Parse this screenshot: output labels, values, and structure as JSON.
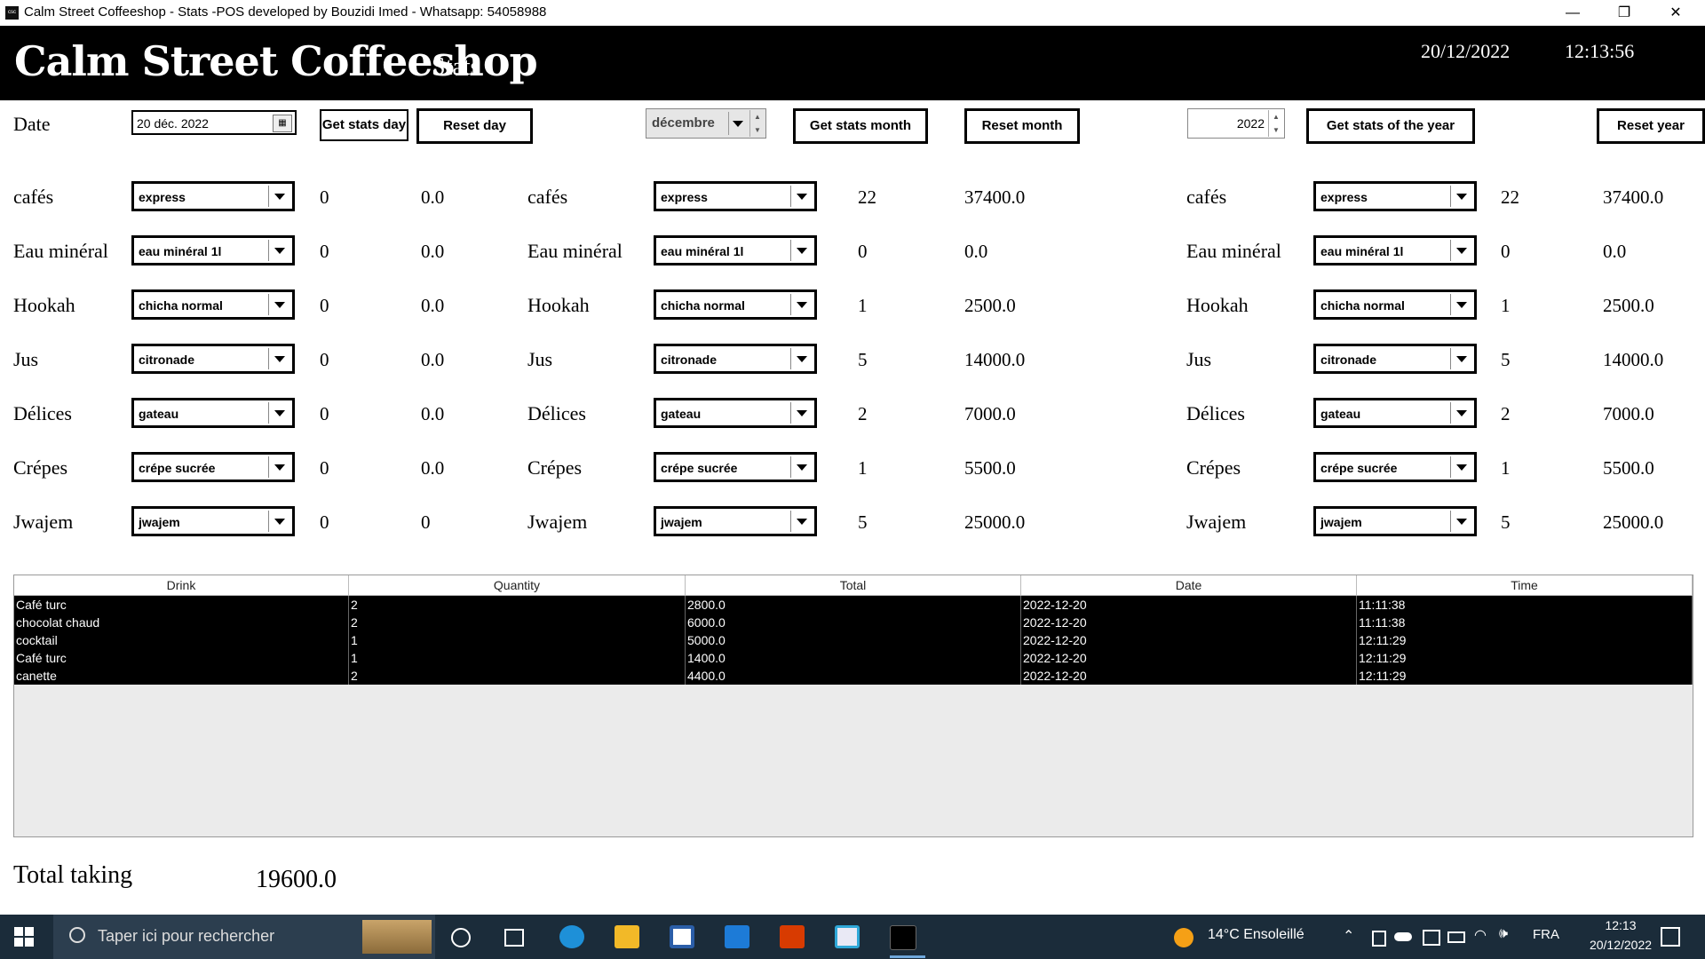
{
  "window": {
    "title": "Calm Street Coffeeshop - Stats -POS developed by Bouzidi Imed - Whatsapp: 54058988",
    "app_icon_text": "csc",
    "minimize": "—",
    "restore": "❐",
    "close": "✕"
  },
  "header": {
    "brand": "Calm Street Coffeeshop",
    "page_title": "Stats",
    "date": "20/12/2022",
    "time": "12:13:56"
  },
  "controls": {
    "date_label": "Date",
    "date_value": "20 déc. 2022",
    "get_day": "Get stats day",
    "reset_day": "Reset day",
    "month_value": "décembre",
    "get_month": "Get stats month",
    "reset_month": "Reset month",
    "year_value": "2022",
    "get_year": "Get stats of the year",
    "reset_year": "Reset year"
  },
  "categories": {
    "day": {
      "labels": [
        "cafés",
        "Eau minéral",
        "Hookah",
        "Jus",
        "Délices",
        "Crépes",
        "Jwajem"
      ],
      "selections": [
        "express",
        "eau minéral 1l",
        "chicha normal",
        "citronade",
        "gateau",
        "crépe sucrée",
        "jwajem"
      ],
      "quantities": [
        "0",
        "0",
        "0",
        "0",
        "0",
        "0",
        "0"
      ],
      "totals": [
        "0.0",
        "0.0",
        "0.0",
        "0.0",
        "0.0",
        "0.0",
        "0"
      ]
    },
    "month": {
      "labels": [
        "cafés",
        "Eau minéral",
        "Hookah",
        "Jus",
        "Délices",
        "Crépes",
        "Jwajem"
      ],
      "selections": [
        "express",
        "eau minéral 1l",
        "chicha normal",
        "citronade",
        "gateau",
        "crépe sucrée",
        "jwajem"
      ],
      "quantities": [
        "22",
        "0",
        "1",
        "5",
        "2",
        "1",
        "5"
      ],
      "totals": [
        "37400.0",
        "0.0",
        "2500.0",
        "14000.0",
        "7000.0",
        "5500.0",
        "25000.0"
      ]
    },
    "year": {
      "labels": [
        "cafés",
        "Eau minéral",
        "Hookah",
        "Jus",
        "Délices",
        "Crépes",
        "Jwajem"
      ],
      "selections": [
        "express",
        "eau minéral 1l",
        "chicha normal",
        "citronade",
        "gateau",
        "crépe sucrée",
        "jwajem"
      ],
      "quantities": [
        "22",
        "0",
        "1",
        "5",
        "2",
        "1",
        "5"
      ],
      "totals": [
        "37400.0",
        "0.0",
        "2500.0",
        "14000.0",
        "7000.0",
        "5500.0",
        "25000.0"
      ]
    }
  },
  "table": {
    "columns": [
      "Drink",
      "Quantity",
      "Total",
      "Date",
      "Time"
    ],
    "rows": [
      [
        "Café turc",
        "2",
        "2800.0",
        "2022-12-20",
        "11:11:38"
      ],
      [
        "chocolat chaud",
        "2",
        "6000.0",
        "2022-12-20",
        "11:11:38"
      ],
      [
        "cocktail",
        "1",
        "5000.0",
        "2022-12-20",
        "12:11:29"
      ],
      [
        "Café turc",
        "1",
        "1400.0",
        "2022-12-20",
        "12:11:29"
      ],
      [
        "canette",
        "2",
        "4400.0",
        "2022-12-20",
        "12:11:29"
      ]
    ]
  },
  "total": {
    "label": "Total taking",
    "value": "19600.0"
  },
  "taskbar": {
    "search_placeholder": "Taper ici pour rechercher",
    "weather": "14°C  Ensoleillé",
    "language": "FRA",
    "clock_time": "12:13",
    "clock_date": "20/12/2022",
    "pinned_icons": [
      "task-view-icon",
      "cortana-icon",
      "edge-icon",
      "file-explorer-icon",
      "store-icon",
      "mail-icon",
      "office-icon",
      "app-cube-icon",
      "csc-app-icon"
    ],
    "colors": {
      "bar": "#1b2c3a",
      "edge": "#1e90d8",
      "folder": "#f2b928",
      "office": "#d83b01",
      "mail": "#1d7bd7"
    }
  }
}
